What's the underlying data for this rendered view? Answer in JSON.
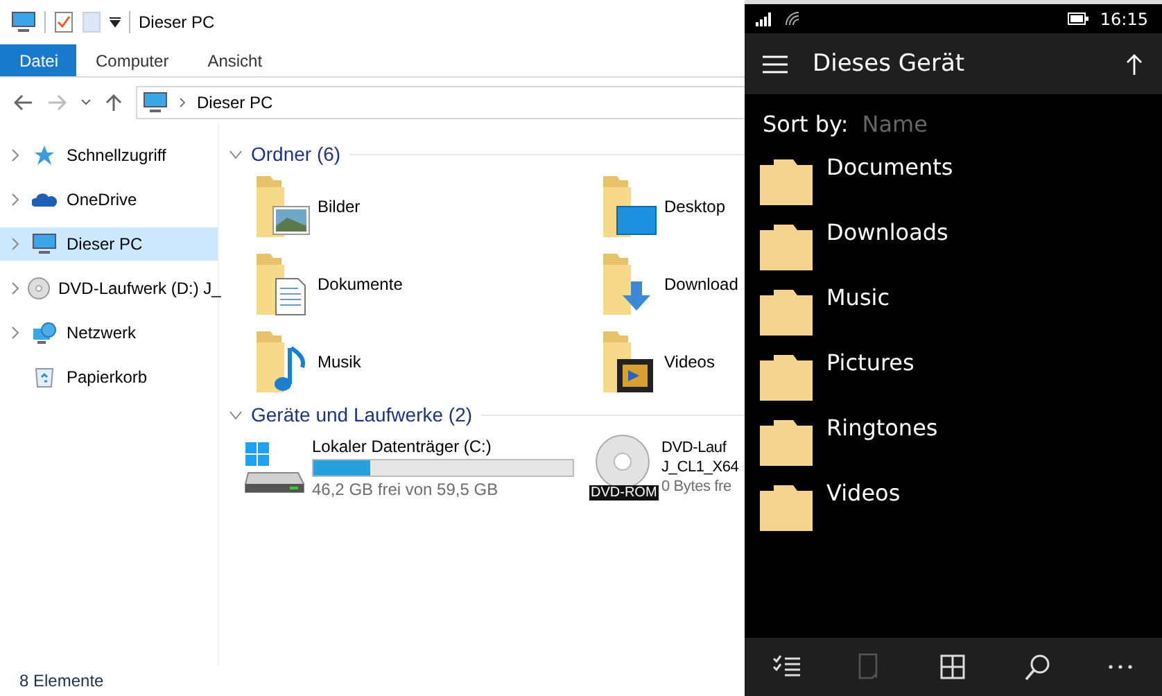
{
  "explorer": {
    "title": "Dieser PC",
    "ribbon_tabs": [
      {
        "label": "Datei",
        "selected": true
      },
      {
        "label": "Computer",
        "selected": false
      },
      {
        "label": "Ansicht",
        "selected": false
      }
    ],
    "address": {
      "path": "Dieser PC"
    },
    "nav": [
      {
        "label": "Schnellzugriff",
        "expandable": true,
        "selected": false
      },
      {
        "label": "OneDrive",
        "expandable": true,
        "selected": false
      },
      {
        "label": "Dieser PC",
        "expandable": true,
        "selected": true
      },
      {
        "label": "DVD-Laufwerk (D:) J_",
        "expandable": true,
        "selected": false
      },
      {
        "label": "Netzwerk",
        "expandable": true,
        "selected": false
      },
      {
        "label": "Papierkorb",
        "expandable": false,
        "selected": false
      }
    ],
    "groups": [
      {
        "title": "Ordner (6)",
        "kind": "folders",
        "expanded": true,
        "items": [
          {
            "label": "Bilder"
          },
          {
            "label": "Desktop"
          },
          {
            "label": "Dokumente"
          },
          {
            "label": "Download"
          },
          {
            "label": "Musik"
          },
          {
            "label": "Videos"
          }
        ]
      },
      {
        "title": "Geräte und Laufwerke (2)",
        "kind": "drives",
        "expanded": true,
        "items": [
          {
            "kind": "disk",
            "lines": [
              "Lokaler Datenträger (C:)"
            ],
            "level": 0.22,
            "free": "46,2 GB frei von 59,5 GB"
          },
          {
            "kind": "dvd",
            "badge": "DVD-ROM",
            "lines": [
              "DVD-Lauf",
              "J_CL1_X64"
            ],
            "free": "0 Bytes fre"
          }
        ]
      }
    ],
    "status_bar": "8 Elemente"
  },
  "phone": {
    "time": "16:15",
    "title": "Dieses Gerät",
    "sort_label": "Sort by:",
    "sort_value": "Name",
    "folders": [
      "Documents",
      "Downloads",
      "Music",
      "Pictures",
      "Ringtones",
      "Videos"
    ],
    "app_bar": [
      {
        "kind": "select",
        "disabled": false
      },
      {
        "kind": "rename",
        "disabled": true
      },
      {
        "kind": "tiles",
        "disabled": false
      },
      {
        "kind": "search",
        "disabled": false
      },
      {
        "kind": "more",
        "disabled": false
      }
    ]
  }
}
